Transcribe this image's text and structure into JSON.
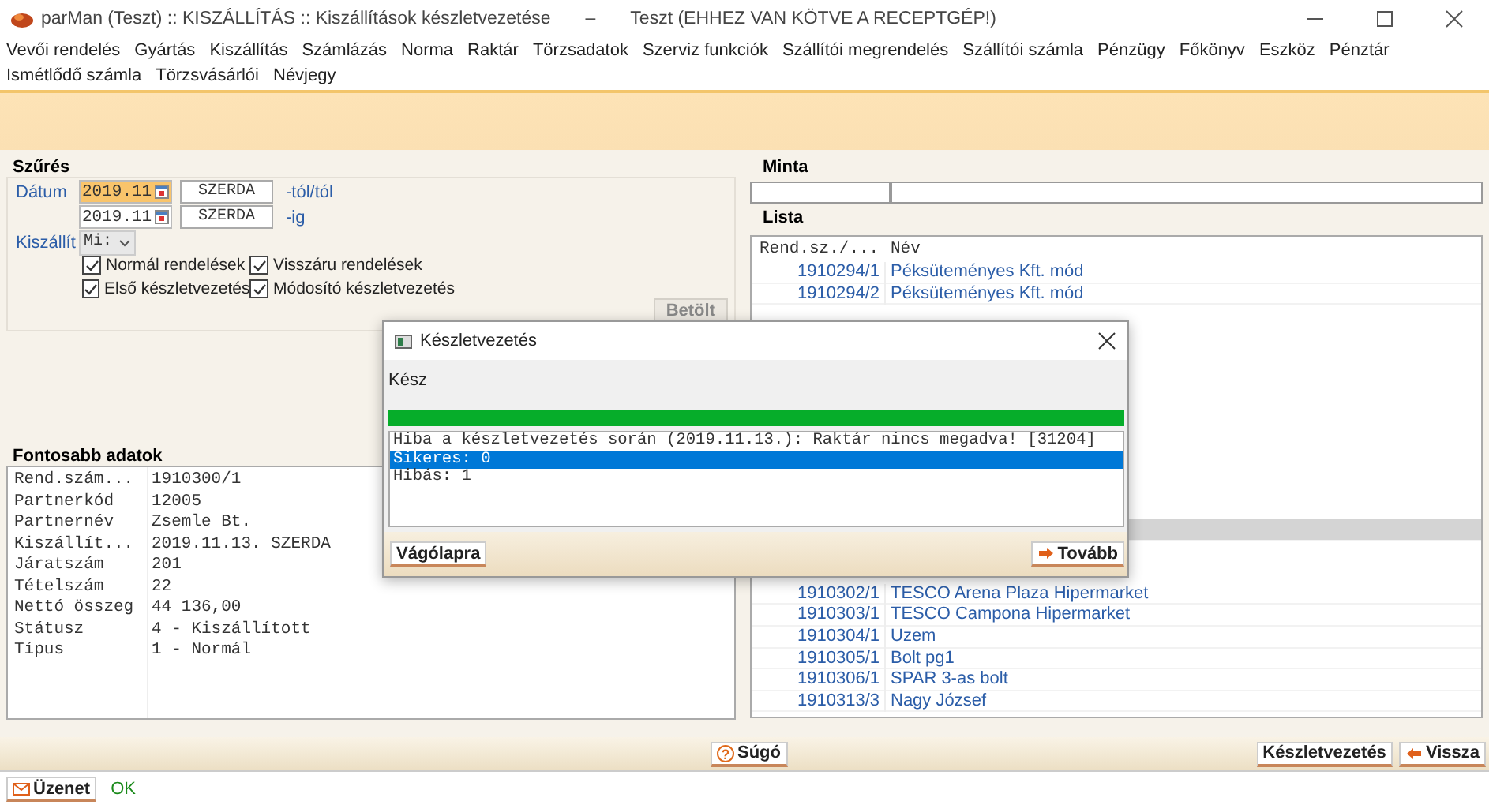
{
  "window": {
    "title": "parMan (Teszt) :: KISZÁLLÍTÁS :: Kiszállítások készletvezetése",
    "separator": "–",
    "subtitle": "Teszt (EHHEZ VAN KÖTVE A RECEPTGÉP!)"
  },
  "menu": [
    "Vevői rendelés",
    "Gyártás",
    "Kiszállítás",
    "Számlázás",
    "Norma",
    "Raktár",
    "Törzsadatok",
    "Szerviz funkciók",
    "Szállítói megrendelés",
    "Szállítói számla",
    "Pénzügy",
    "Főkönyv",
    "Eszköz",
    "Pénztár",
    "Ismétlődő számla",
    "Törzsvásárlói",
    "Névjegy"
  ],
  "filter": {
    "title": "Szűrés",
    "date_label": "Dátum",
    "dates": [
      {
        "value": "2019.11",
        "day": "SZERDA",
        "suffix": "-tól/tól",
        "focused": true
      },
      {
        "value": "2019.11",
        "day": "SZERDA",
        "suffix": "-ig",
        "focused": false
      }
    ],
    "carrier_label": "Kiszállít",
    "carrier_value": "Mi:",
    "checkboxes": [
      {
        "label": "Normál rendelések",
        "checked": true
      },
      {
        "label": "Visszáru rendelések",
        "checked": true
      },
      {
        "label": "Első készletvezetés",
        "checked": true
      },
      {
        "label": "Módosító készletvezetés",
        "checked": true
      }
    ],
    "load_button": "Betölt"
  },
  "details": {
    "title": "Fontosabb adatok",
    "rows": [
      {
        "label": "Rend.szám...",
        "value": "1910300/1"
      },
      {
        "label": "Partnerkód",
        "value": "12005"
      },
      {
        "label": "Partnernév",
        "value": "Zsemle Bt."
      },
      {
        "label": "Kiszállít...",
        "value": "2019.11.13. SZERDA"
      },
      {
        "label": "Járatszám",
        "value": "201"
      },
      {
        "label": "Tételszám",
        "value": "22"
      },
      {
        "label": "Nettó összeg",
        "value": "44 136,00"
      },
      {
        "label": "Státusz",
        "value": "4 - Kiszállított"
      },
      {
        "label": "Típus",
        "value": "1 - Normál"
      }
    ]
  },
  "pattern": {
    "title": "Minta"
  },
  "list": {
    "title": "Lista",
    "columns": [
      "Rend.sz./...",
      "Név"
    ],
    "rows": [
      {
        "kind": "row",
        "number": "1910294/1",
        "name": "Péksüteményes Kft. mód",
        "selected": false
      },
      {
        "kind": "row",
        "number": "1910294/2",
        "name": "Péksüteményes Kft. mód",
        "selected": false
      },
      {
        "kind": "covered",
        "selected": true
      },
      {
        "kind": "row",
        "number": "1910302/1",
        "name": "TESCO Arena Plaza Hipermarket",
        "selected": false
      },
      {
        "kind": "row",
        "number": "1910303/1",
        "name": "TESCO Campona Hipermarket",
        "selected": false
      },
      {
        "kind": "row",
        "number": "1910304/1",
        "name": "Uzem",
        "selected": false
      },
      {
        "kind": "row",
        "number": "1910305/1",
        "name": "Bolt pg1",
        "selected": false
      },
      {
        "kind": "row",
        "number": "1910306/1",
        "name": "SPAR 3-as bolt",
        "selected": false
      },
      {
        "kind": "row",
        "number": "1910313/3",
        "name": "Nagy József",
        "selected": false
      }
    ]
  },
  "dialog": {
    "title": "Készletvezetés",
    "status": "Kész",
    "level": 1,
    "lines": [
      {
        "text": "Hiba a készletvezetés során (2019.11.13.): Raktár nincs megadva! [31204]",
        "selected": false
      },
      {
        "text": "Sikeres: 0",
        "selected": true
      },
      {
        "text": "Hibás: 1",
        "selected": false
      }
    ],
    "buttons": [
      {
        "label": "Vágólapra",
        "kind": "plain"
      },
      {
        "label": "Tovább",
        "kind": "forward"
      }
    ]
  },
  "toolbar": {
    "help_icon": "?",
    "help": "Súgó",
    "buttons": [
      {
        "label": "Készletvezetés",
        "kind": "plain"
      },
      {
        "label": "Vissza",
        "kind": "back"
      }
    ]
  },
  "status_bar": {
    "button": "Üzenet",
    "message": "OK"
  }
}
